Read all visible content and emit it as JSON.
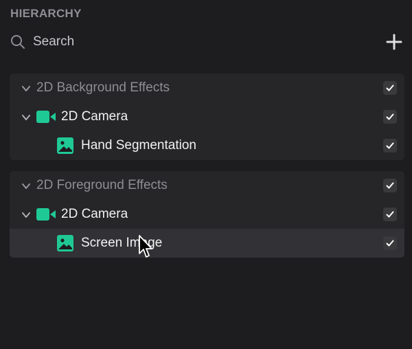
{
  "panel": {
    "title": "HIERARCHY"
  },
  "search": {
    "placeholder": "Search"
  },
  "colors": {
    "background": "#1d1c1f",
    "group_bg": "#262528",
    "selected_bg": "#323135",
    "accent": "#1fc995",
    "muted_text": "#8e8e93"
  },
  "groups": [
    {
      "label": "2D Background Effects",
      "camera": {
        "label": "2D Camera",
        "icon": "camera-icon"
      },
      "child": {
        "label": "Hand Segmentation",
        "icon": "image-icon"
      }
    },
    {
      "label": "2D Foreground Effects",
      "camera": {
        "label": "2D Camera",
        "icon": "camera-icon"
      },
      "child": {
        "label": "Screen Image",
        "icon": "image-icon"
      }
    }
  ]
}
